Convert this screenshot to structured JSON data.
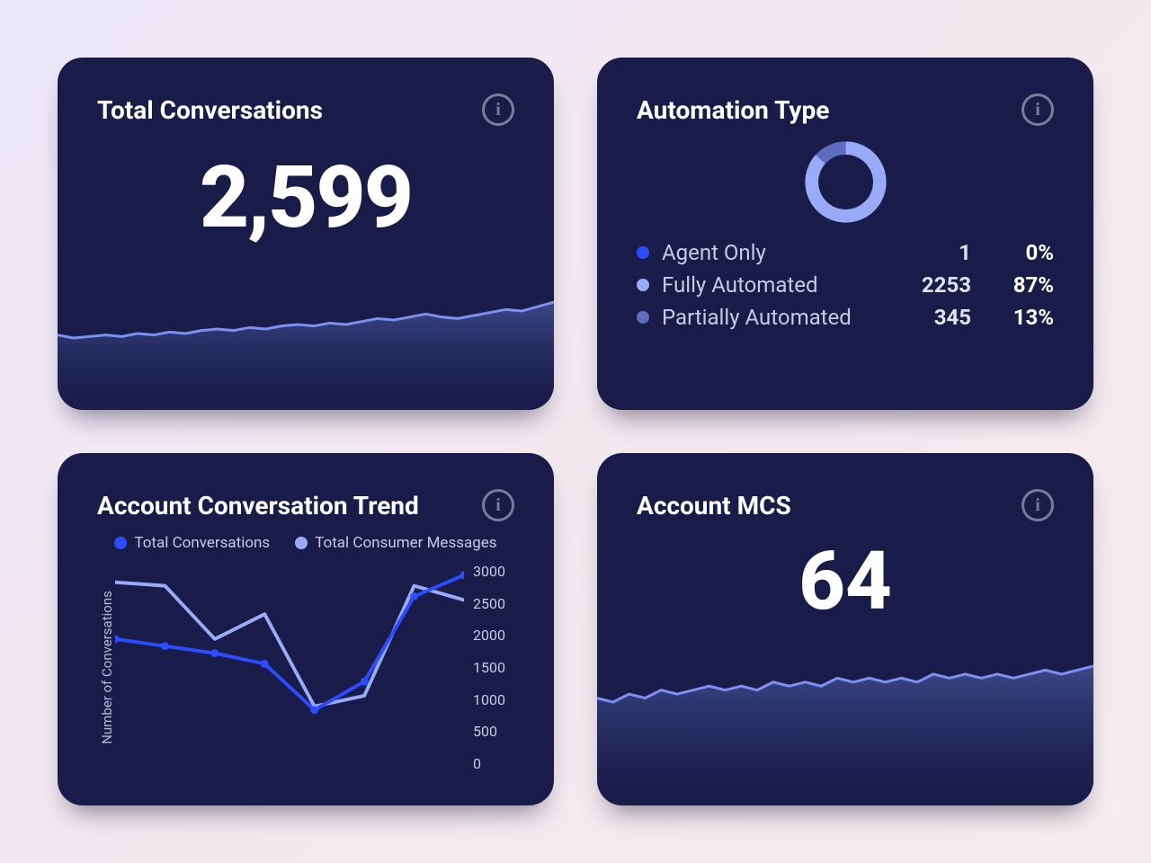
{
  "cards": {
    "total_conversations": {
      "title": "Total Conversations",
      "value": "2,599"
    },
    "automation_type": {
      "title": "Automation Type",
      "legend": [
        {
          "label": "Agent Only",
          "count": "1",
          "pct": "0%",
          "color": "#2c4cff"
        },
        {
          "label": "Fully Automated",
          "count": "2253",
          "pct": "87%",
          "color": "#98abf8"
        },
        {
          "label": "Partially Automated",
          "count": "345",
          "pct": "13%",
          "color": "#5e6cc0"
        }
      ]
    },
    "trend": {
      "title": "Account Conversation Trend",
      "ylabel": "Number of\nConversations",
      "legend": {
        "series_a": "Total Conversations",
        "series_b": "Total Consumer Messages"
      },
      "yticks": [
        "3000",
        "2500",
        "2000",
        "1500",
        "1000",
        "500",
        "0"
      ]
    },
    "mcs": {
      "title": "Account MCS",
      "value": "64"
    }
  },
  "colors": {
    "series_a": "#2c4cff",
    "series_b": "#98abf8",
    "series_c": "#5e6cc0",
    "spark_line": "#7d8ff0",
    "spark_fill_top": "#3b4888",
    "spark_fill_bot": "#1b1e4c"
  },
  "chart_data": [
    {
      "type": "area",
      "card": "total_conversations_sparkline",
      "values": [
        46,
        44,
        45,
        46,
        45,
        47,
        46,
        48,
        47,
        49,
        50,
        49,
        51,
        50,
        52,
        53,
        52,
        54,
        53,
        55,
        57,
        56,
        58,
        60,
        58,
        57,
        59,
        61,
        63,
        62,
        65,
        68
      ]
    },
    {
      "type": "pie",
      "card": "automation_type_donut",
      "title": "Automation Type",
      "series": [
        {
          "name": "Agent Only",
          "value": 1,
          "pct": 0,
          "color": "#2c4cff"
        },
        {
          "name": "Fully Automated",
          "value": 2253,
          "pct": 87,
          "color": "#98abf8"
        },
        {
          "name": "Partially Automated",
          "value": 345,
          "pct": 13,
          "color": "#5e6cc0"
        }
      ]
    },
    {
      "type": "line",
      "card": "account_conversation_trend",
      "title": "Account Conversation Trend",
      "ylabel": "Number of Conversations",
      "ylim": [
        0,
        3000
      ],
      "x": [
        1,
        2,
        3,
        4,
        5,
        6,
        7,
        8
      ],
      "series": [
        {
          "name": "Total Conversations",
          "color": "#2c4cff",
          "values": [
            1900,
            1800,
            1700,
            1550,
            900,
            1300,
            2500,
            2800
          ]
        },
        {
          "name": "Total Consumer Messages",
          "color": "#98abf8",
          "values": [
            2700,
            2650,
            1900,
            2250,
            950,
            1100,
            2650,
            2450
          ]
        }
      ]
    },
    {
      "type": "area",
      "card": "account_mcs_sparkline",
      "values": [
        58,
        57,
        59,
        58,
        60,
        59,
        60,
        61,
        60,
        61,
        60,
        62,
        61,
        62,
        61,
        63,
        62,
        63,
        62,
        63,
        62,
        64,
        63,
        64,
        63,
        64,
        63,
        64,
        65,
        64,
        65,
        66
      ]
    }
  ]
}
